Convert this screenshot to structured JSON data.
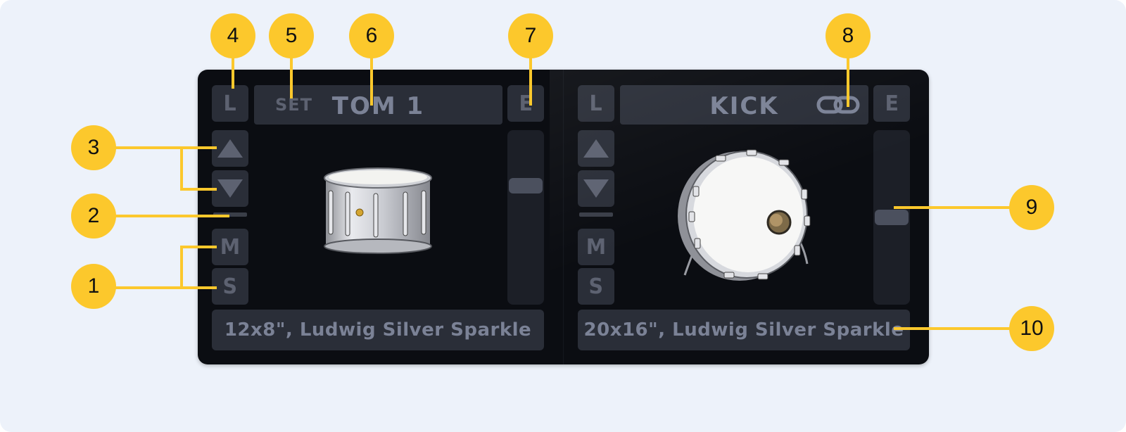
{
  "callouts": [
    "1",
    "2",
    "3",
    "4",
    "5",
    "6",
    "7",
    "8",
    "9",
    "10"
  ],
  "colors": {
    "callout": "#fcc82c",
    "panel": "#0b0d12",
    "button": "#2a2e38",
    "text": "#7b8296"
  },
  "slots": [
    {
      "load_label": "L",
      "set_label": "SET",
      "name": "TOM 1",
      "edit_label": "E",
      "mute_label": "M",
      "solo_label": "S",
      "description": "12x8\", Ludwig Silver Sparkle",
      "volume_level": 0.7,
      "image": "tom-drum"
    },
    {
      "load_label": "L",
      "name": "KICK",
      "edit_label": "E",
      "mute_label": "M",
      "solo_label": "S",
      "description": "20x16\", Ludwig Silver Sparkle",
      "volume_level": 0.5,
      "image": "kick-drum",
      "linked_icon": "link-icon"
    }
  ]
}
